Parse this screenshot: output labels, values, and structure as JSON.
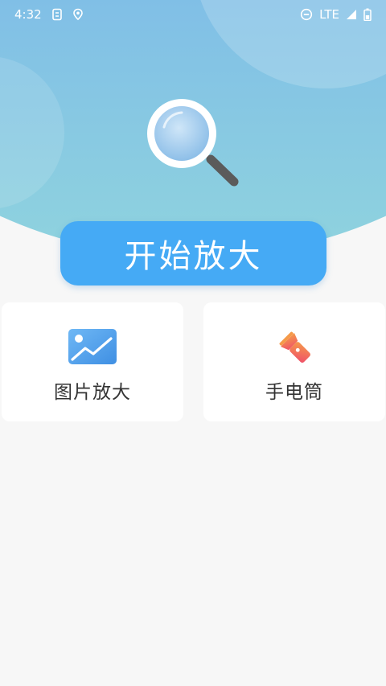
{
  "status_bar": {
    "time": "4:32",
    "network": "LTE",
    "icons": [
      "sim-icon",
      "location-icon",
      "do-not-disturb-icon",
      "signal-icon",
      "battery-icon"
    ]
  },
  "hero": {
    "icon": "magnifier-icon",
    "colors": {
      "gradient_top": "#6e9ff0",
      "gradient_bottom": "#8fd3de"
    }
  },
  "start_button": {
    "label": "开始放大",
    "color": "#45aaf5"
  },
  "features": [
    {
      "label": "图片放大",
      "icon": "image-icon"
    },
    {
      "label": "手电筒",
      "icon": "flashlight-icon"
    }
  ]
}
